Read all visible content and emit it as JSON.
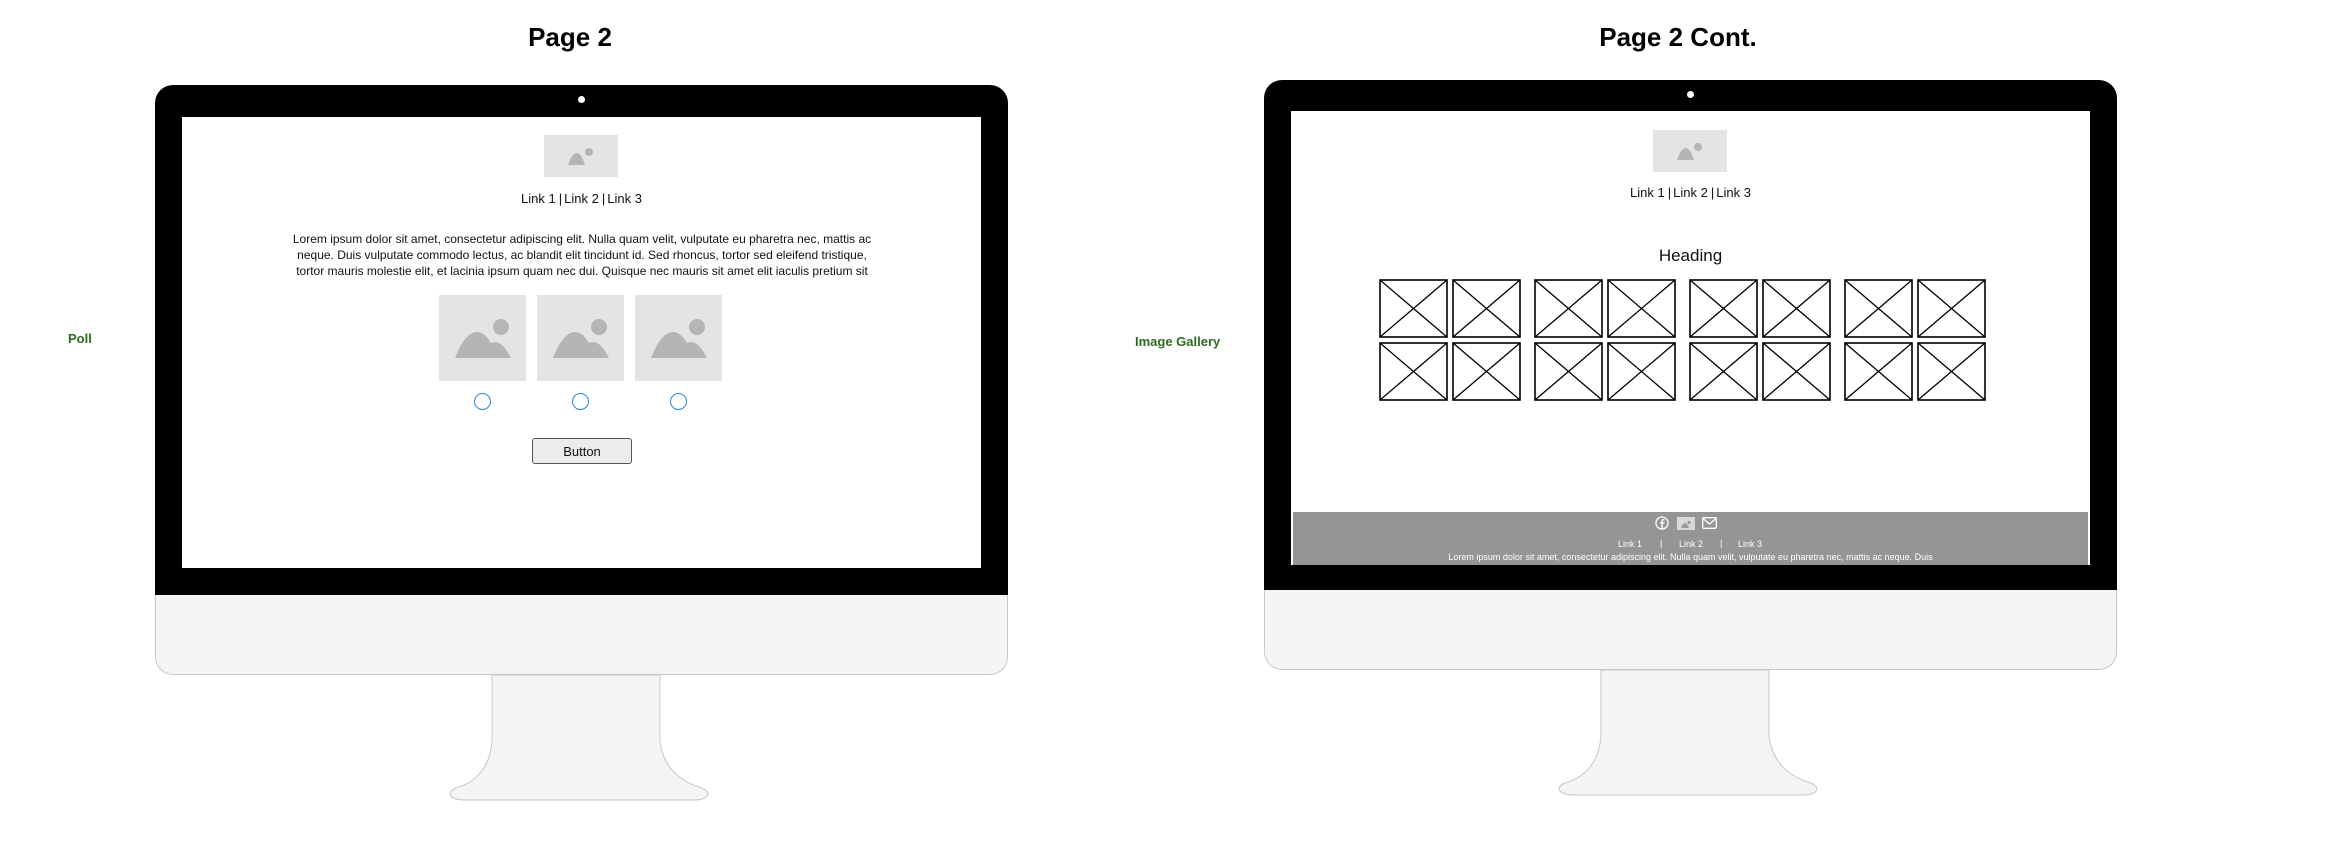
{
  "left_panel": {
    "title": "Page 2",
    "side_label": "Poll",
    "nav": {
      "link1": "Link 1",
      "sep1": "|",
      "link2": "Link 2",
      "sep2": "|",
      "link3": "Link 3"
    },
    "paragraph": {
      "line1": "Lorem ipsum dolor sit amet, consectetur adipiscing elit. Nulla quam velit, vulputate eu pharetra nec, mattis ac",
      "line2": "neque. Duis vulputate commodo lectus, ac blandit elit tincidunt id. Sed rhoncus, tortor sed eleifend tristique,",
      "line3": "tortor mauris molestie elit, et lacinia ipsum quam nec dui. Quisque nec mauris sit amet elit iaculis pretium sit"
    },
    "poll_options": [
      {
        "icon": "image-placeholder-icon",
        "selected": false
      },
      {
        "icon": "image-placeholder-icon",
        "selected": false
      },
      {
        "icon": "image-placeholder-icon",
        "selected": false
      }
    ],
    "button_label": "Button"
  },
  "right_panel": {
    "title": "Page 2 Cont.",
    "side_label": "Image Gallery",
    "nav": {
      "link1": "Link 1",
      "sep1": "|",
      "link2": "Link 2",
      "sep2": "|",
      "link3": "Link 3"
    },
    "heading": "Heading",
    "gallery": {
      "rows": 2,
      "groups": 4,
      "per_group": 2
    },
    "footer": {
      "icons": [
        "facebook-icon",
        "image-placeholder-icon",
        "mail-icon"
      ],
      "links": [
        "Link 1",
        "Link 2",
        "Link 3"
      ],
      "separator": "|",
      "text": "Lorem ipsum dolor sit amet, consectetur adipiscing elit. Nulla quam velit, vulputate eu pharetra nec, mattis ac neque. Duis"
    }
  },
  "colors": {
    "bezel": "#000000",
    "chin": "#f4f4f4",
    "placeholder": "#e4e4e4",
    "radio": "#2b86d6",
    "side_label": "#2e6b1f",
    "footer": "#959595"
  }
}
